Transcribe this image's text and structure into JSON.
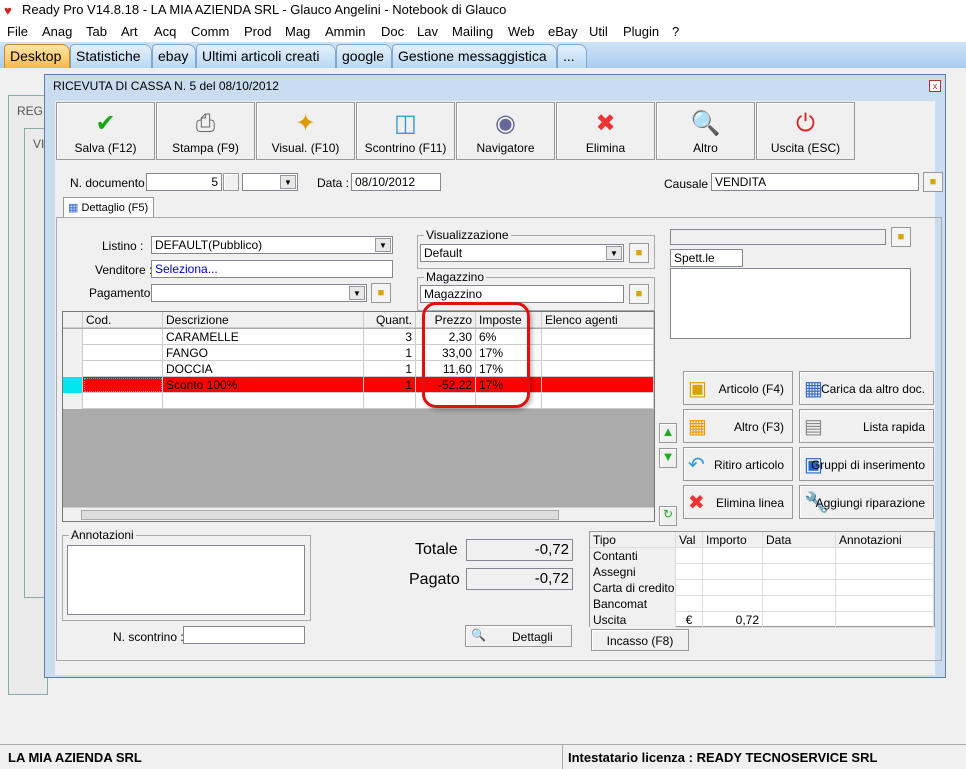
{
  "app": {
    "title": "Ready Pro V14.8.18 - LA MIA AZIENDA SRL - Glauco Angelini - Notebook di Glauco"
  },
  "menu": [
    "File",
    "Anag",
    "Tab",
    "Art",
    "Acq",
    "Comm",
    "Prod",
    "Mag",
    "Ammin",
    "Doc",
    "Lav",
    "Mailing",
    "Web",
    "eBay",
    "Util",
    "Plugin",
    "?"
  ],
  "tabs": [
    "Desktop",
    "Statistiche",
    "ebay",
    "Ultimi articoli creati",
    "google",
    "Gestione messaggistica",
    "..."
  ],
  "background_windows": {
    "title1": "REGI",
    "title2": "VI"
  },
  "dialog": {
    "title": "RICEVUTA DI CASSA N. 5  del 08/10/2012",
    "toolbar": [
      {
        "label": "Salva (F12)",
        "icon": "check-icon"
      },
      {
        "label": "Stampa (F9)",
        "icon": "printer-icon"
      },
      {
        "label": "Visual. (F10)",
        "icon": "magic-wand-icon"
      },
      {
        "label": "Scontrino (F11)",
        "icon": "cash-register-icon"
      },
      {
        "label": "Navigatore",
        "icon": "compass-icon"
      },
      {
        "label": "Elimina",
        "icon": "delete-icon"
      },
      {
        "label": "Altro",
        "icon": "search-book-icon"
      },
      {
        "label": "Uscita (ESC)",
        "icon": "exit-icon"
      }
    ],
    "ndoc_label": "N. documento :",
    "ndoc_value": "5",
    "data_label": "Data :",
    "data_value": "08/10/2012",
    "causale_label": "Causale :",
    "causale_value": "VENDITA",
    "detail_tab": "Dettaglio (F5)",
    "listino_label": "Listino :",
    "listino_value": "DEFAULT(Pubblico)",
    "venditore_label": "Venditore :",
    "venditore_value": "Seleziona...",
    "pagamento_label": "Pagamento :",
    "pagamento_value": "",
    "visualizzazione_label": "Visualizzazione",
    "visualizzazione_value": "Default",
    "magazzino_label": "Magazzino",
    "magazzino_value": "Magazzino",
    "customer_field": "",
    "spett_value": "Spett.le",
    "grid": {
      "columns": [
        "Cod.",
        "Descrizione",
        "Quant.",
        "Prezzo",
        "Imposte",
        "Elenco agenti"
      ],
      "rows": [
        {
          "cod": "",
          "desc": "CARAMELLE",
          "qty": "3",
          "price": "2,30",
          "tax": "6%",
          "agents": ""
        },
        {
          "cod": "",
          "desc": "FANGO",
          "qty": "1",
          "price": "33,00",
          "tax": "17%",
          "agents": ""
        },
        {
          "cod": "",
          "desc": "DOCCIA",
          "qty": "1",
          "price": "11,60",
          "tax": "17%",
          "agents": ""
        },
        {
          "cod": "",
          "desc": "Sconto 100%",
          "qty": "1",
          "price": "-52,22",
          "tax": "17%",
          "agents": "",
          "selected": true
        }
      ],
      "highlight_color": "#ff0000"
    },
    "side_buttons": [
      {
        "label": "Articolo (F4)",
        "icon": "box-add-icon"
      },
      {
        "label": "Carica da altro doc.",
        "icon": "grid-check-icon"
      },
      {
        "label": "Altro (F3)",
        "icon": "grid-add-icon"
      },
      {
        "label": "Lista rapida",
        "icon": "scroll-add-icon"
      },
      {
        "label": "Ritiro articolo",
        "icon": "undo-arrow-icon"
      },
      {
        "label": "Gruppi di inserimento",
        "icon": "group-add-icon"
      },
      {
        "label": "Elimina linea",
        "icon": "delete-icon"
      },
      {
        "label": "Aggiungi riparazione",
        "icon": "wrench-icon"
      }
    ],
    "annotazioni_label": "Annotazioni",
    "nscontrino_label": "N. scontrino :",
    "nscontrino_value": "",
    "totale_label": "Totale",
    "totale_value": "-0,72",
    "pagato_label": "Pagato",
    "pagato_value": "-0,72",
    "dettagli_label": "Dettagli",
    "incasso_label": "Incasso (F8)",
    "payments": {
      "columns": [
        "Tipo",
        "Val",
        "Importo",
        "Data",
        "Annotazioni"
      ],
      "rows": [
        {
          "tipo": "Contanti",
          "val": "",
          "importo": "",
          "data": "",
          "note": ""
        },
        {
          "tipo": "Assegni",
          "val": "",
          "importo": "",
          "data": "",
          "note": ""
        },
        {
          "tipo": "Carta di credito",
          "val": "",
          "importo": "",
          "data": "",
          "note": ""
        },
        {
          "tipo": "Bancomat",
          "val": "",
          "importo": "",
          "data": "",
          "note": ""
        },
        {
          "tipo": "Uscita",
          "val": "€",
          "importo": "0,72",
          "data": "",
          "note": ""
        }
      ]
    }
  },
  "status": {
    "left": "LA MIA AZIENDA SRL",
    "right": "Intestatario licenza : READY TECNOSERVICE SRL"
  }
}
